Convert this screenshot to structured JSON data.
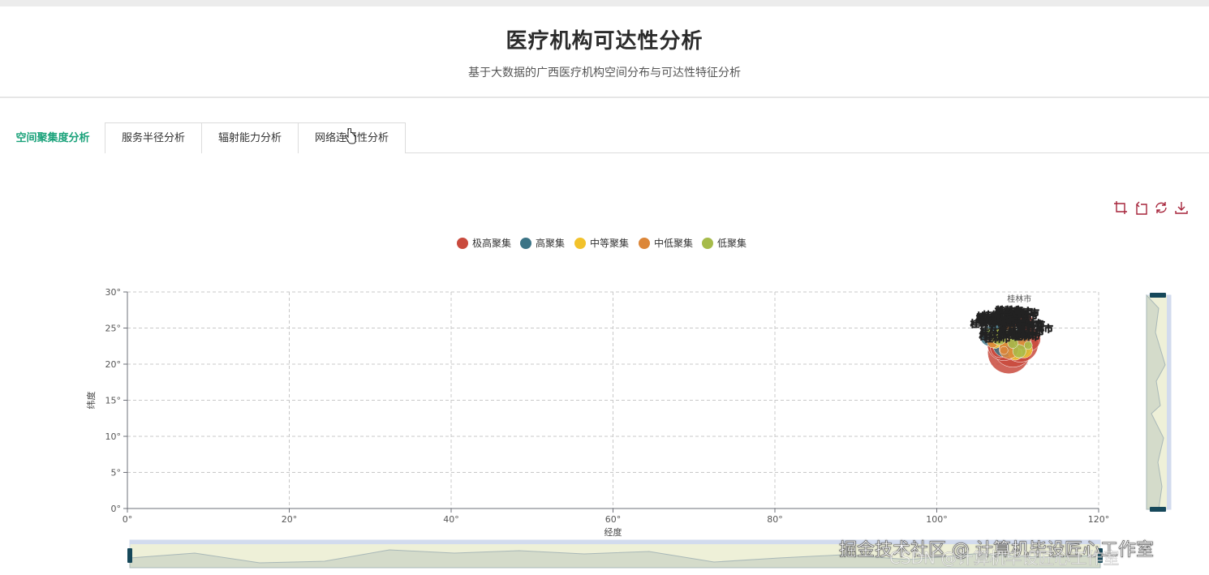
{
  "header": {
    "title": "医疗机构可达性分析",
    "subtitle": "基于大数据的广西医疗机构空间分布与可达性特征分析"
  },
  "tabs": [
    {
      "label": "空间聚集度分析",
      "active": true
    },
    {
      "label": "服务半径分析",
      "active": false
    },
    {
      "label": "辐射能力分析",
      "active": false
    },
    {
      "label": "网络连通性分析",
      "active": false
    }
  ],
  "toolbox": [
    "zoom-icon",
    "zoom-reset-icon",
    "restore-icon",
    "download-icon"
  ],
  "legend": [
    {
      "name": "极高聚集",
      "color": "#c94a3d"
    },
    {
      "name": "高聚集",
      "color": "#3b7486"
    },
    {
      "name": "中等聚集",
      "color": "#f2c22b"
    },
    {
      "name": "中低聚集",
      "color": "#dc8638"
    },
    {
      "name": "低聚集",
      "color": "#a6bb4a"
    }
  ],
  "chart_data": {
    "type": "scatter",
    "xlabel": "经度",
    "ylabel": "纬度",
    "xlim": [
      0,
      120
    ],
    "ylim": [
      0,
      30
    ],
    "x_ticks": [
      "0°",
      "20°",
      "40°",
      "60°",
      "80°",
      "100°",
      "120°"
    ],
    "y_ticks": [
      "0°",
      "5°",
      "10°",
      "15°",
      "20°",
      "25°",
      "30°"
    ],
    "grid": true,
    "legend_position": "top-center",
    "point_label": "桂林市",
    "series": [
      {
        "name": "极高聚集",
        "points": [
          [
            108.9,
            21.6
          ],
          [
            109.4,
            22.3
          ],
          [
            110.3,
            22.8
          ],
          [
            108.3,
            22.8
          ],
          [
            110.2,
            25.3
          ],
          [
            109.4,
            24.3
          ],
          [
            111.3,
            23.5
          ],
          [
            108.6,
            23.3
          ],
          [
            107.8,
            22.2
          ],
          [
            110.9,
            24.6
          ]
        ]
      },
      {
        "name": "高聚集",
        "points": [
          [
            109.6,
            23.1
          ],
          [
            110.1,
            22.6
          ],
          [
            108.4,
            22.6
          ],
          [
            106.6,
            23.9
          ],
          [
            107.4,
            24.7
          ]
        ]
      },
      {
        "name": "中等聚集",
        "points": [
          [
            108.0,
            23.6
          ],
          [
            110.8,
            22.0
          ],
          [
            109.7,
            21.5
          ],
          [
            107.2,
            22.9
          ],
          [
            111.0,
            24.1
          ]
        ]
      },
      {
        "name": "中低聚集",
        "points": [
          [
            108.9,
            22.1
          ],
          [
            110.6,
            23.2
          ],
          [
            109.0,
            24.8
          ],
          [
            106.9,
            23.0
          ],
          [
            108.3,
            21.9
          ]
        ]
      },
      {
        "name": "低聚集",
        "points": [
          [
            107.7,
            23.8
          ],
          [
            110.2,
            21.8
          ],
          [
            109.4,
            22.9
          ],
          [
            106.5,
            24.4
          ],
          [
            111.3,
            22.6
          ],
          [
            108.7,
            24.1
          ]
        ]
      }
    ]
  },
  "datazoom": {
    "x_range": [
      0,
      100
    ],
    "y_range": [
      0,
      100
    ]
  },
  "watermark": "掘金技术社区 @ 计算机毕设匠心工作室",
  "watermark2": "CSDN @计算机毕设匠心工作室"
}
